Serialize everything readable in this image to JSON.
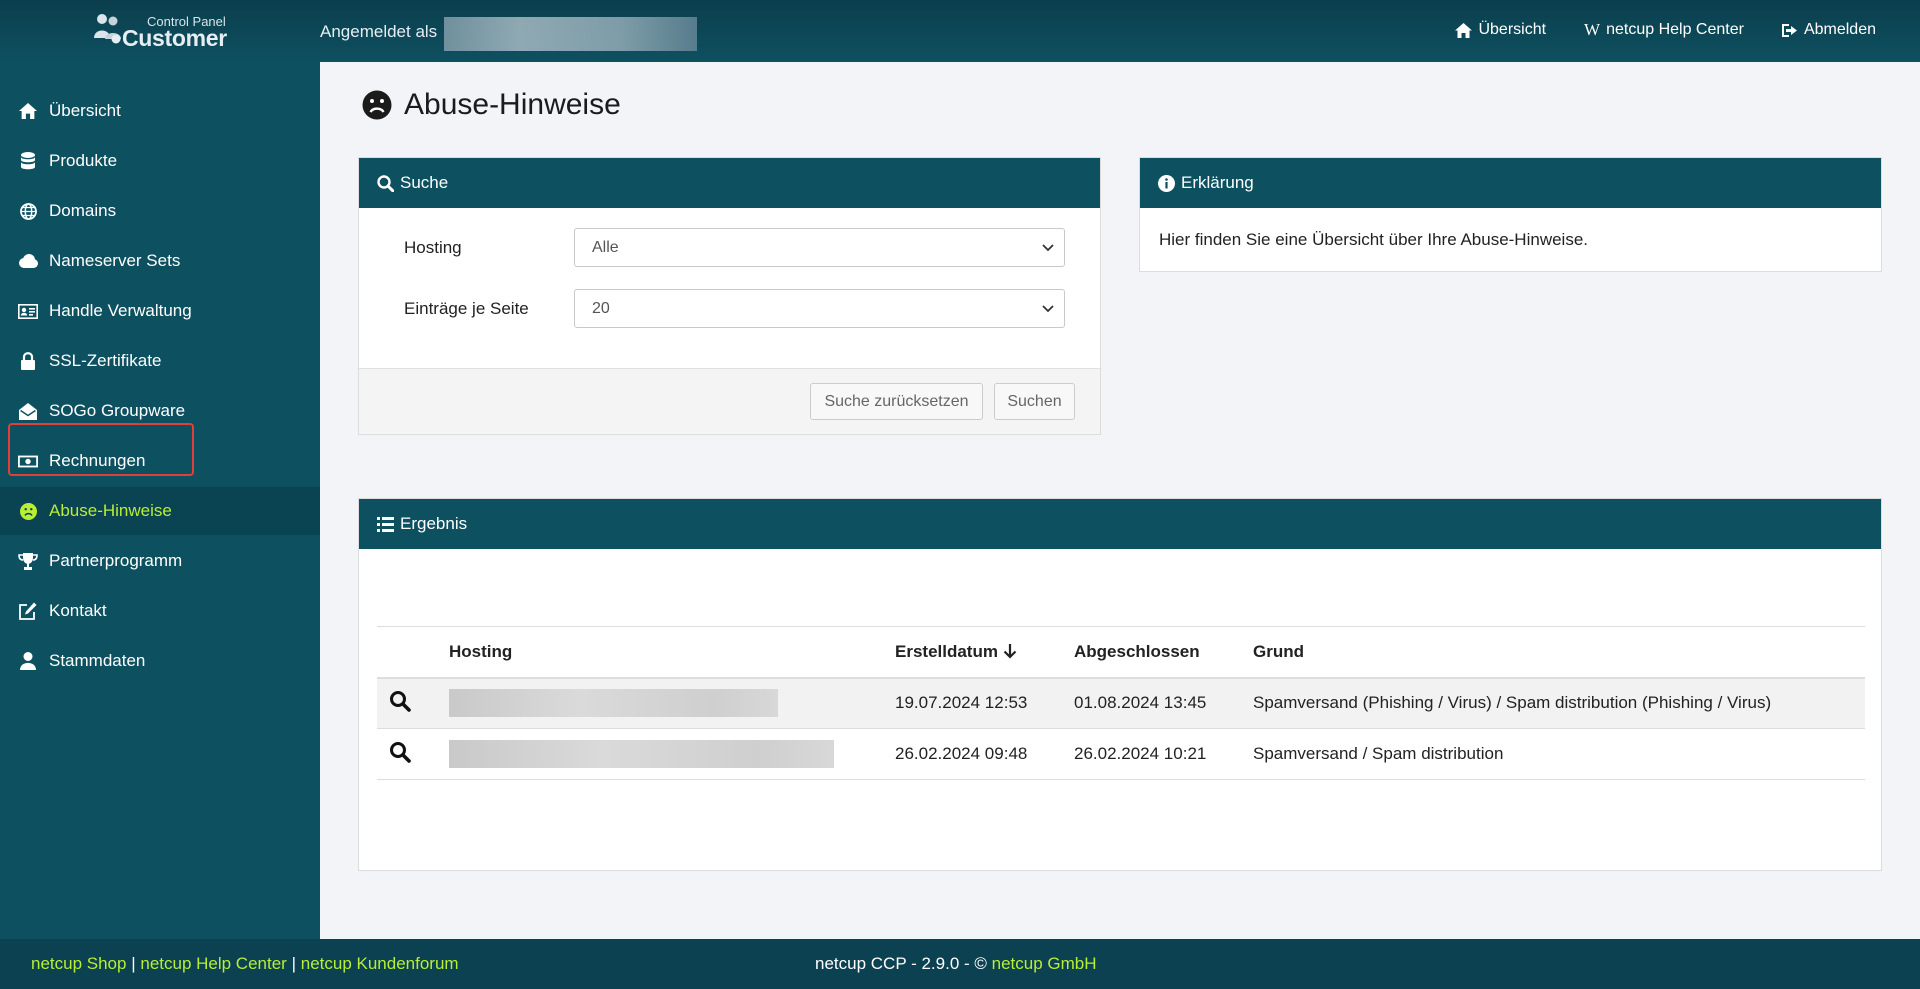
{
  "header": {
    "logo_small": "Control Panel",
    "logo_big": "Customer",
    "logged_in_label": "Angemeldet als",
    "nav": [
      {
        "label": "Übersicht",
        "icon": "home-icon"
      },
      {
        "label": "netcup Help Center",
        "icon": "wikipedia-w-icon"
      },
      {
        "label": "Abmelden",
        "icon": "sign-out-icon"
      }
    ]
  },
  "sidebar": {
    "items": [
      {
        "label": "Übersicht",
        "icon": "home-icon"
      },
      {
        "label": "Produkte",
        "icon": "database-icon"
      },
      {
        "label": "Domains",
        "icon": "globe-icon"
      },
      {
        "label": "Nameserver Sets",
        "icon": "cloud-icon"
      },
      {
        "label": "Handle Verwaltung",
        "icon": "id-card-icon"
      },
      {
        "label": "SSL-Zertifikate",
        "icon": "lock-icon"
      },
      {
        "label": "SOGo Groupware",
        "icon": "envelope-open-icon"
      },
      {
        "label": "Rechnungen",
        "icon": "money-icon"
      },
      {
        "label": "Abuse-Hinweise",
        "icon": "frown-icon",
        "active": true
      },
      {
        "label": "Partnerprogramm",
        "icon": "trophy-icon"
      },
      {
        "label": "Kontakt",
        "icon": "edit-icon"
      },
      {
        "label": "Stammdaten",
        "icon": "user-icon"
      }
    ]
  },
  "page": {
    "title": "Abuse-Hinweise"
  },
  "search": {
    "title": "Suche",
    "hosting_label": "Hosting",
    "hosting_value": "Alle",
    "entries_label": "Einträge je Seite",
    "entries_value": "20",
    "reset_button": "Suche zurücksetzen",
    "search_button": "Suchen"
  },
  "info": {
    "title": "Erklärung",
    "text": "Hier finden Sie eine Übersicht über Ihre Abuse-Hinweise."
  },
  "results": {
    "title": "Ergebnis",
    "columns": [
      "Hosting",
      "Erstelldatum",
      "Abgeschlossen",
      "Grund"
    ],
    "rows": [
      {
        "created": "19.07.2024 12:53",
        "closed": "01.08.2024 13:45",
        "reason": "Spamversand (Phishing / Virus) / Spam distribution (Phishing / Virus)"
      },
      {
        "created": "26.02.2024 09:48",
        "closed": "26.02.2024 10:21",
        "reason": "Spamversand / Spam distribution"
      }
    ]
  },
  "footer": {
    "shop": "netcup Shop",
    "help": "netcup Help Center",
    "forum": "netcup Kundenforum",
    "sep": "|",
    "version": "netcup CCP - 2.9.0 - ©",
    "company": "netcup GmbH"
  },
  "colors": {
    "brand_dark": "#0d5060",
    "accent_green": "#b8ef34",
    "highlight_red": "#e0403a"
  }
}
